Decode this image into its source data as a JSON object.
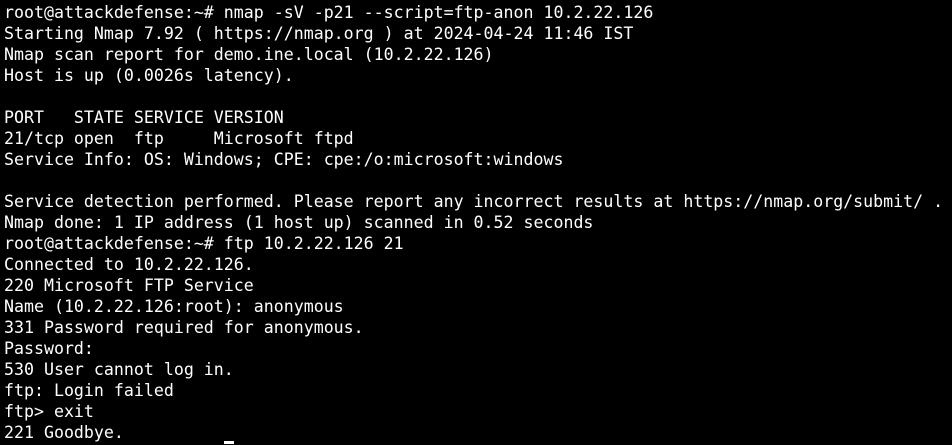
{
  "terminal": {
    "lines": [
      "root@attackdefense:~# nmap -sV -p21 --script=ftp-anon 10.2.22.126",
      "Starting Nmap 7.92 ( https://nmap.org ) at 2024-04-24 11:46 IST",
      "Nmap scan report for demo.ine.local (10.2.22.126)",
      "Host is up (0.0026s latency).",
      "",
      "PORT   STATE SERVICE VERSION",
      "21/tcp open  ftp     Microsoft ftpd",
      "Service Info: OS: Windows; CPE: cpe:/o:microsoft:windows",
      "",
      "Service detection performed. Please report any incorrect results at https://nmap.org/submit/ .",
      "Nmap done: 1 IP address (1 host up) scanned in 0.52 seconds",
      "root@attackdefense:~# ftp 10.2.22.126 21",
      "Connected to 10.2.22.126.",
      "220 Microsoft FTP Service",
      "Name (10.2.22.126:root): anonymous",
      "331 Password required for anonymous.",
      "Password:",
      "530 User cannot log in.",
      "ftp: Login failed",
      "ftp> exit",
      "221 Goodbye."
    ]
  },
  "colors": {
    "background": "#000000",
    "foreground": "#ffffff"
  }
}
